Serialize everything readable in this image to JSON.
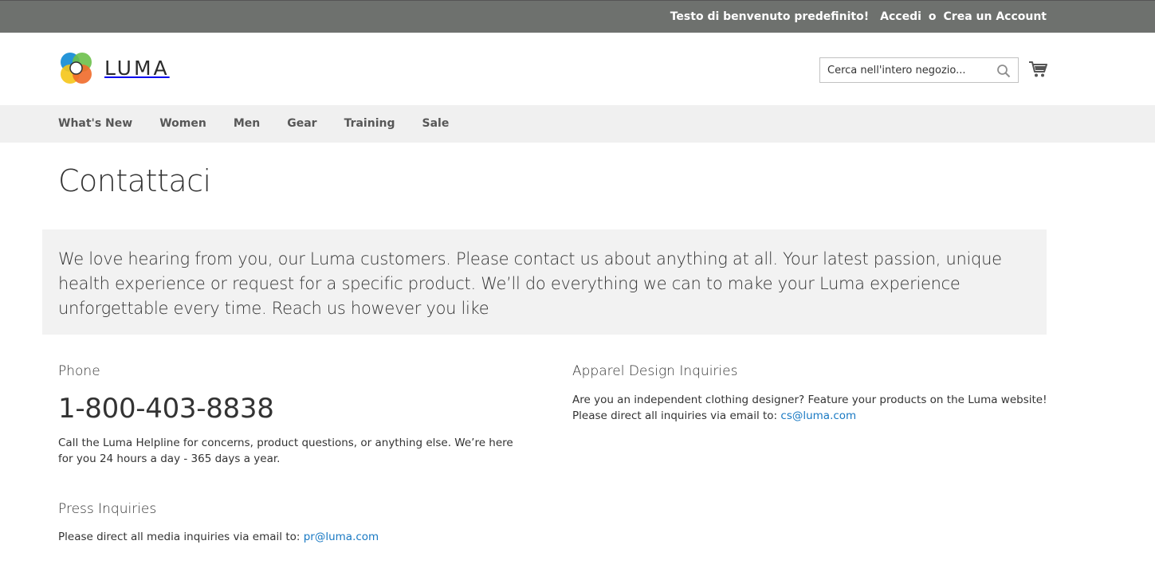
{
  "top_panel": {
    "welcome": "Testo di benvenuto predefinito!",
    "sign_in": "Accedi",
    "separator": "o",
    "create_account": "Crea un Account"
  },
  "header": {
    "logo_text": "LUMA",
    "search_placeholder": "Cerca nell'intero negozio..."
  },
  "nav": {
    "items": [
      "What's New",
      "Women",
      "Men",
      "Gear",
      "Training",
      "Sale"
    ]
  },
  "page": {
    "title": "Contattaci",
    "intro": "We love hearing from you, our Luma customers. Please contact us about anything at all. Your latest passion, unique health experience or request for a specific product. We’ll do everything we can to make your Luma experience unforgettable every time. Reach us however you like"
  },
  "phone_section": {
    "heading": "Phone",
    "number": "1-800-403-8838",
    "text": "Call the Luma Helpline for concerns, product questions, or anything else. We’re here for you 24 hours a day - 365 days a year."
  },
  "press_section": {
    "heading": "Press Inquiries",
    "text": "Please direct all media inquiries via email to: ",
    "email": "pr@luma.com"
  },
  "apparel_section": {
    "heading": "Apparel Design Inquiries",
    "text": "Are you an independent clothing designer? Feature your products on the Luma website! Please direct all inquiries via email to: ",
    "email": "cs@luma.com"
  },
  "colors": {
    "top_panel_bg": "#6e716e",
    "nav_bg": "#f0f0f0",
    "intro_bg": "#f2f2f2",
    "link": "#1979c3"
  }
}
